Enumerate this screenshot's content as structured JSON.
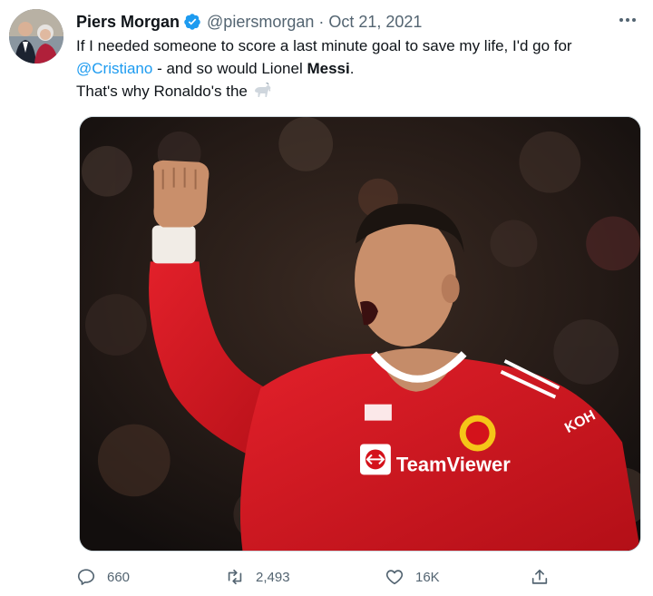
{
  "tweet": {
    "author": {
      "name": "Piers Morgan",
      "handle": "@piersmorgan",
      "separator": "·",
      "date": "Oct 21, 2021",
      "verified": true
    },
    "text": {
      "line1": "If I needed someone to score a last minute goal to save my life, I'd go for",
      "mention": "@Cristiano",
      "line2_mid": " - and so would Lionel ",
      "line2_bold": "Messi",
      "line2_end": ".",
      "line3": "That's why Ronaldo's the ",
      "emoji": "goat-icon"
    },
    "media": {
      "description_icon": "photo-ronaldo-celebrating",
      "jersey_text": "TeamViewer",
      "sleeve_text": "KOH"
    },
    "actions": {
      "replies": "660",
      "retweets": "2,493",
      "likes": "16K"
    }
  },
  "colors": {
    "accent": "#1d9bf0",
    "text": "#0f1419",
    "muted": "#536471",
    "jersey_red": "#d4121b"
  }
}
